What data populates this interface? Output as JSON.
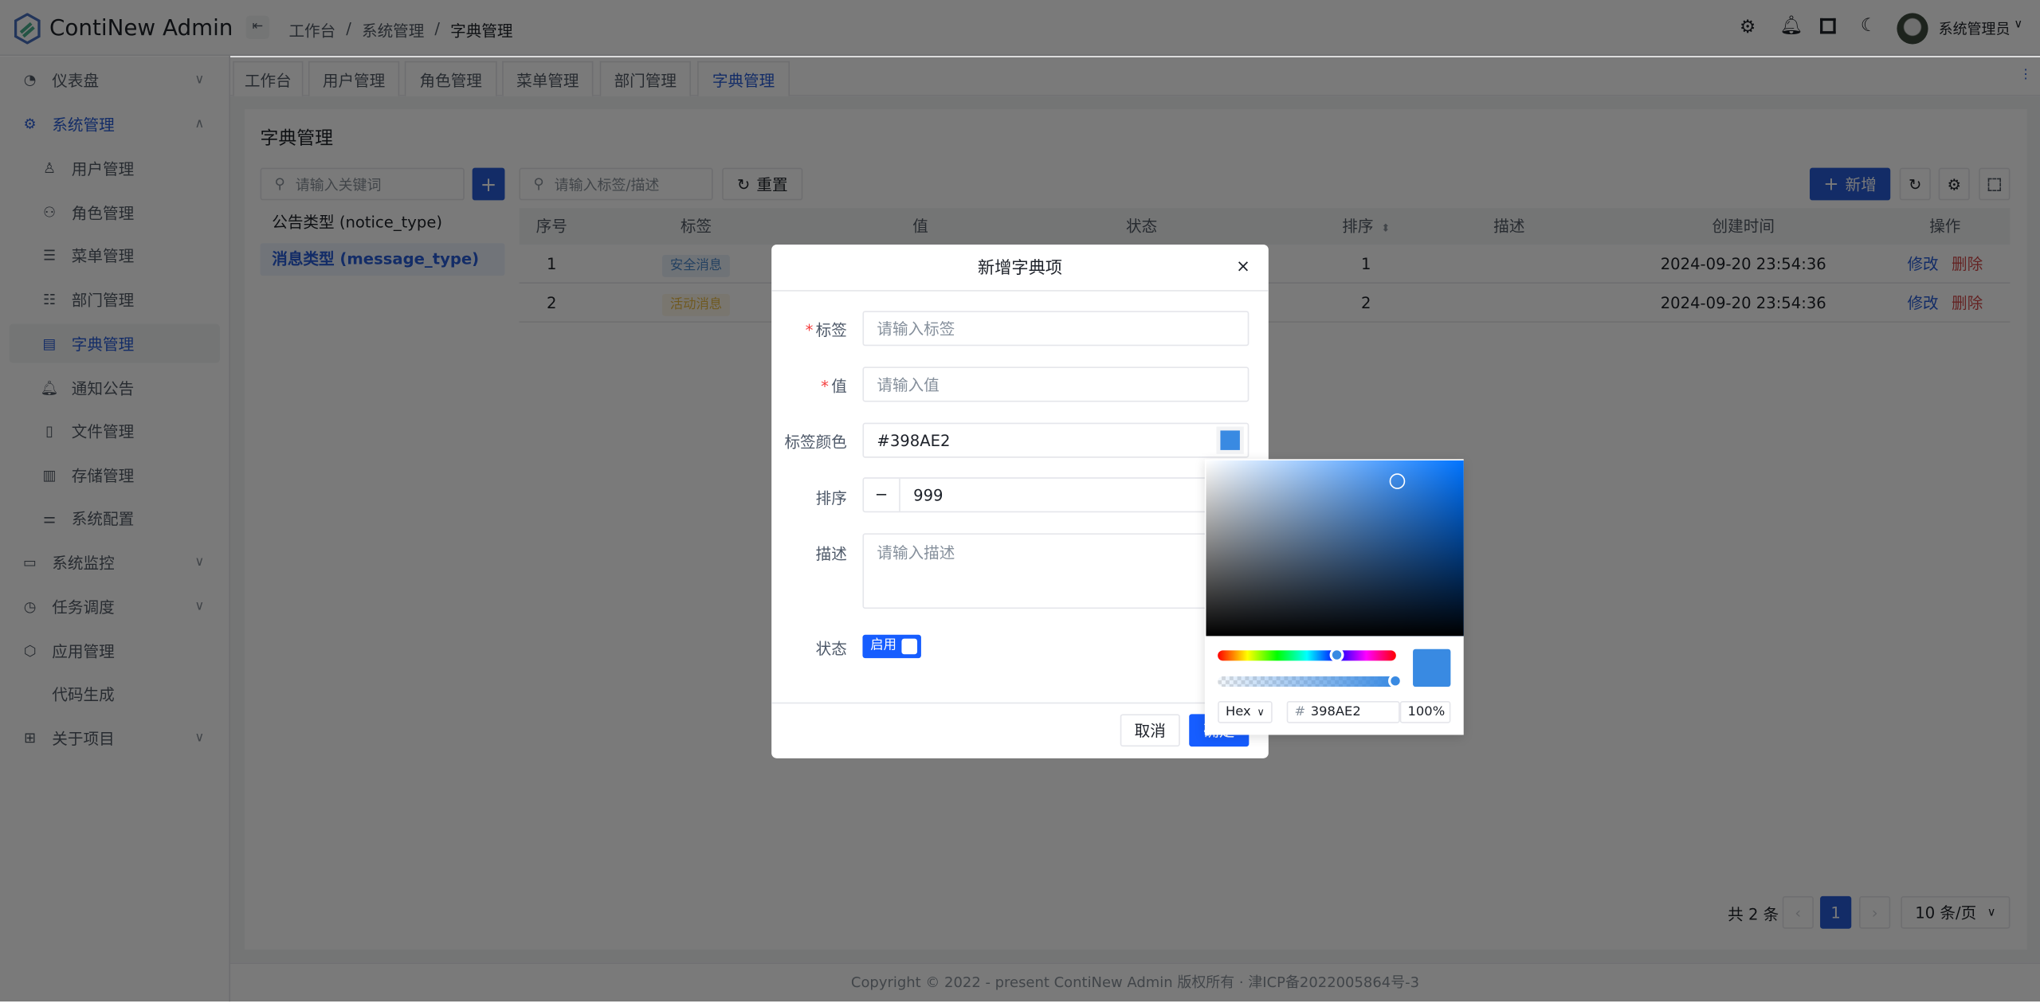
{
  "app": {
    "title": "ContiNew Admin"
  },
  "header": {
    "breadcrumb": [
      "工作台",
      "系统管理",
      "字典管理"
    ],
    "user": "系统管理员",
    "icons": [
      "gear-icon",
      "bell-icon",
      "fullscreen-icon",
      "moon-icon"
    ]
  },
  "sidebar": {
    "items": [
      {
        "label": "仪表盘",
        "icon": "dashboard-icon",
        "chevron": "down"
      },
      {
        "label": "系统管理",
        "icon": "gear-icon",
        "chevron": "up",
        "active": true
      },
      {
        "label": "用户管理",
        "icon": "user-icon",
        "sub": true
      },
      {
        "label": "角色管理",
        "icon": "users-icon",
        "sub": true
      },
      {
        "label": "菜单管理",
        "icon": "menu-icon",
        "sub": true
      },
      {
        "label": "部门管理",
        "icon": "list-icon",
        "sub": true
      },
      {
        "label": "字典管理",
        "icon": "dict-icon",
        "sub": true,
        "selected": true
      },
      {
        "label": "通知公告",
        "icon": "bell-icon",
        "sub": true
      },
      {
        "label": "文件管理",
        "icon": "file-icon",
        "sub": true
      },
      {
        "label": "存储管理",
        "icon": "storage-icon",
        "sub": true
      },
      {
        "label": "系统配置",
        "icon": "sliders-icon",
        "sub": true
      },
      {
        "label": "系统监控",
        "icon": "monitor-icon",
        "chevron": "down"
      },
      {
        "label": "任务调度",
        "icon": "clock-icon",
        "chevron": "down"
      },
      {
        "label": "应用管理",
        "icon": "cube-icon"
      },
      {
        "label": "代码生成",
        "icon": "code-icon"
      },
      {
        "label": "关于项目",
        "icon": "grid-icon",
        "chevron": "down"
      }
    ]
  },
  "tabs": [
    {
      "label": "工作台"
    },
    {
      "label": "用户管理"
    },
    {
      "label": "角色管理"
    },
    {
      "label": "菜单管理"
    },
    {
      "label": "部门管理"
    },
    {
      "label": "字典管理",
      "active": true
    }
  ],
  "page": {
    "title": "字典管理",
    "left": {
      "search_placeholder": "请输入关键词",
      "items": [
        "公告类型 (notice_type)",
        "消息类型 (message_type)"
      ],
      "selected": 1
    },
    "toolbar": {
      "search_placeholder": "请输入标签/描述",
      "reset": "重置",
      "add": "新增"
    },
    "table": {
      "columns": [
        "序号",
        "标签",
        "值",
        "状态",
        "排序",
        "描述",
        "创建时间",
        "操作"
      ],
      "rows": [
        {
          "index": "1",
          "tag": "安全消息",
          "tag_color": "#398AE2",
          "sort": "1",
          "created": "2024-09-20 23:54:36",
          "edit": "修改",
          "delete": "删除"
        },
        {
          "index": "2",
          "tag": "活动消息",
          "tag_color": "#F7BA1E",
          "sort": "2",
          "created": "2024-09-20 23:54:36",
          "edit": "修改",
          "delete": "删除"
        }
      ]
    },
    "pagination": {
      "total": "共 2 条",
      "current": "1",
      "page_size": "10 条/页"
    }
  },
  "footer": {
    "text": "Copyright © 2022 - present ContiNew Admin 版权所有 · 津ICP备2022005864号-3"
  },
  "modal": {
    "title": "新增字典项",
    "fields": {
      "label": {
        "label": "标签",
        "placeholder": "请输入标签",
        "required": true
      },
      "value": {
        "label": "值",
        "placeholder": "请输入值",
        "required": true
      },
      "color": {
        "label": "标签颜色",
        "value": "#398AE2"
      },
      "sort": {
        "label": "排序",
        "value": "999"
      },
      "desc": {
        "label": "描述",
        "placeholder": "请输入描述"
      },
      "status": {
        "label": "状态",
        "value": "启用",
        "on": true
      }
    },
    "cancel": "取消",
    "ok": "确定"
  },
  "color_picker": {
    "format": "Hex",
    "hex_prefix": "#",
    "hex": "398AE2",
    "alpha": "100",
    "alpha_unit": "%",
    "color": "#398AE2"
  }
}
